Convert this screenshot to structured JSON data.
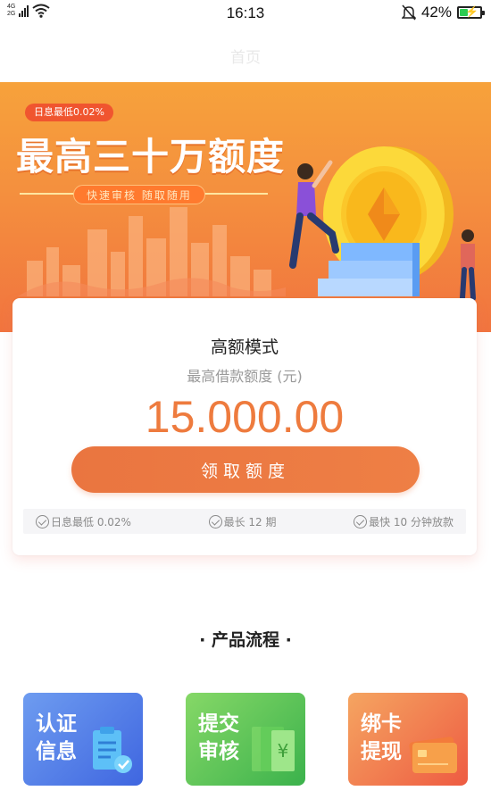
{
  "status_bar": {
    "net_top": "4G",
    "net_bottom": "2G",
    "time": "16:13",
    "battery_percent": "42%",
    "battery_level": 0.42
  },
  "nav": {
    "title": "首页"
  },
  "banner": {
    "pill": "日息最低0.02%",
    "headline": "最高三十万额度",
    "subline": "快速审核  随取随用"
  },
  "card": {
    "title": "高额模式",
    "subtitle": "最高借款额度 (元)",
    "amount": "15.000.00",
    "button_label": "领取额度",
    "features": [
      "日息最低 0.02%",
      "最长 12 期",
      "最快 10 分钟放款"
    ]
  },
  "process": {
    "title": "· 产品流程 ·",
    "steps": [
      {
        "line1": "认证",
        "line2": "信息",
        "icon": "clipboard-check-icon"
      },
      {
        "line1": "提交",
        "line2": "审核",
        "icon": "banknote-icon"
      },
      {
        "line1": "绑卡",
        "line2": "提现",
        "icon": "bank-card-icon"
      }
    ]
  },
  "colors": {
    "accent": "#ee7b3e",
    "button": "#ea7540",
    "step1": "#4a72e6",
    "step2": "#4cbd55",
    "step3": "#f07548"
  }
}
